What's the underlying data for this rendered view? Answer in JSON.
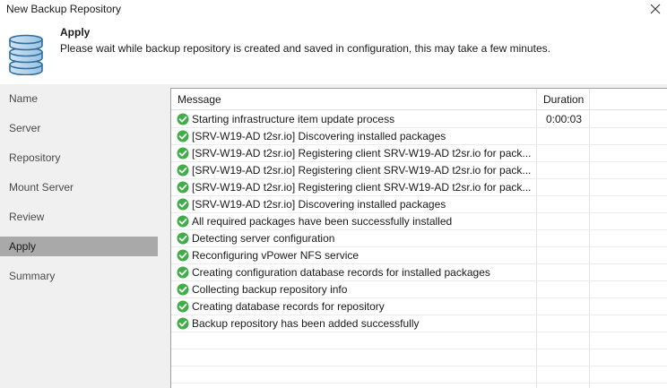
{
  "window": {
    "title": "New Backup Repository"
  },
  "header": {
    "title": "Apply",
    "description": "Please wait while backup repository is created and saved in configuration, this may take a few minutes."
  },
  "sidebar": {
    "items": [
      {
        "label": "Name"
      },
      {
        "label": "Server"
      },
      {
        "label": "Repository"
      },
      {
        "label": "Mount Server"
      },
      {
        "label": "Review"
      },
      {
        "label": "Apply",
        "active": true
      },
      {
        "label": "Summary"
      }
    ]
  },
  "log": {
    "columns": {
      "message": "Message",
      "duration": "Duration"
    },
    "rows": [
      {
        "status": "success",
        "message": "Starting infrastructure item update process",
        "duration": "0:00:03"
      },
      {
        "status": "success",
        "message": "[SRV-W19-AD t2sr.io] Discovering installed packages",
        "duration": ""
      },
      {
        "status": "success",
        "message": "[SRV-W19-AD t2sr.io] Registering client SRV-W19-AD t2sr.io  for pack...",
        "duration": ""
      },
      {
        "status": "success",
        "message": "[SRV-W19-AD t2sr.io] Registering client SRV-W19-AD t2sr.io  for pack...",
        "duration": ""
      },
      {
        "status": "success",
        "message": "[SRV-W19-AD t2sr.io] Registering client SRV-W19-AD t2sr.io  for pack...",
        "duration": ""
      },
      {
        "status": "success",
        "message": "[SRV-W19-AD t2sr.io] Discovering installed packages",
        "duration": ""
      },
      {
        "status": "success",
        "message": "All required packages have been successfully installed",
        "duration": ""
      },
      {
        "status": "success",
        "message": "Detecting server configuration",
        "duration": ""
      },
      {
        "status": "success",
        "message": "Reconfiguring vPower NFS service",
        "duration": ""
      },
      {
        "status": "success",
        "message": "Creating configuration database records for installed packages",
        "duration": ""
      },
      {
        "status": "success",
        "message": "Collecting backup repository info",
        "duration": ""
      },
      {
        "status": "success",
        "message": "Creating database records for repository",
        "duration": ""
      },
      {
        "status": "success",
        "message": "Backup repository has been added successfully",
        "duration": ""
      }
    ]
  },
  "icons": {
    "header": "database-icon",
    "status": "success-check-icon",
    "close": "close-icon"
  },
  "colors": {
    "success": "#3fae49",
    "database": "#2f6f9f",
    "active_nav": "#a9a9a9"
  }
}
